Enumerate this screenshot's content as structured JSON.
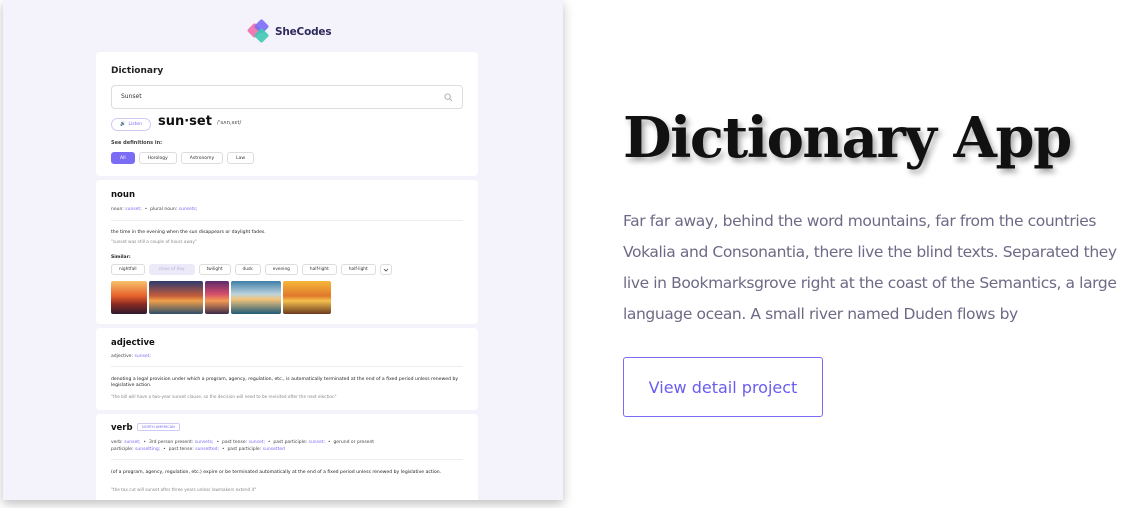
{
  "mockup": {
    "brand": "SheCodes",
    "dictionary_title": "Dictionary",
    "search": {
      "value": "Sunset"
    },
    "listen_label": "Listen",
    "word": "sun·set",
    "phonetic": "/ˈsʌnˌsɛt/",
    "see_definitions_label": "See definitions in:",
    "categories": [
      "All",
      "Horology",
      "Astronomy",
      "Law"
    ],
    "noun": {
      "title": "noun",
      "forms_prefix": "noun:",
      "forms_word": "sunset;",
      "plural_prefix": "plural noun:",
      "plural_word": "sunsets;",
      "definition": "the time in the evening when the sun disappears or daylight fades.",
      "example": "\"sunset was still a couple of hours away\"",
      "similar_label": "Similar:",
      "similar": [
        "nightfall",
        "close of day",
        "twilight",
        "dusk",
        "evening",
        "half-light",
        "half-light"
      ]
    },
    "adjective": {
      "title": "adjective",
      "forms_prefix": "adjective:",
      "forms_word": "sunset;",
      "definition": "denoting a legal provision under which a program, agency, regulation, etc., is automatically terminated at the end of a fixed period unless renewed by legislative action.",
      "example": "\"the bill will have a two-year sunset clause, so the decision will need to be revisited after the next election\""
    },
    "verb": {
      "title": "verb",
      "badge": "NORTH AMERICAN",
      "forms_line1_a": "verb:",
      "forms_line1_b": "sunset;",
      "forms_line1_c": "3rd person present:",
      "forms_line1_d": "sunsets;",
      "forms_line1_e": "past tense:",
      "forms_line1_f": "sunset;",
      "forms_line1_g": "past participle:",
      "forms_line1_h": "sunset;",
      "forms_line1_i": "gerund or present",
      "forms_line2_a": "participle:",
      "forms_line2_b": "sunsetting;",
      "forms_line2_c": "past tense:",
      "forms_line2_d": "sunsetted;",
      "forms_line2_e": "past participle:",
      "forms_line2_f": "sunsetted",
      "definition": "(of a program, agency, regulation, etc.) expire or be terminated automatically at the end of a fixed period unless renewed by legislative action.",
      "example": "\"the tax cut will sunset after three years unless lawmakers extend it\""
    }
  },
  "project": {
    "title": "Dictionary App",
    "description": "Far far away, behind the word mountains, far from the countries Vokalia and Consonantia, there live the blind texts. Separated they live in Bookmarksgrove right at the coast of the Semantics, a large language ocean. A small river named Duden flows by",
    "cta_label": "View detail project"
  },
  "colors": {
    "accent": "#7b6cf6",
    "text_muted": "#6d6a86"
  }
}
